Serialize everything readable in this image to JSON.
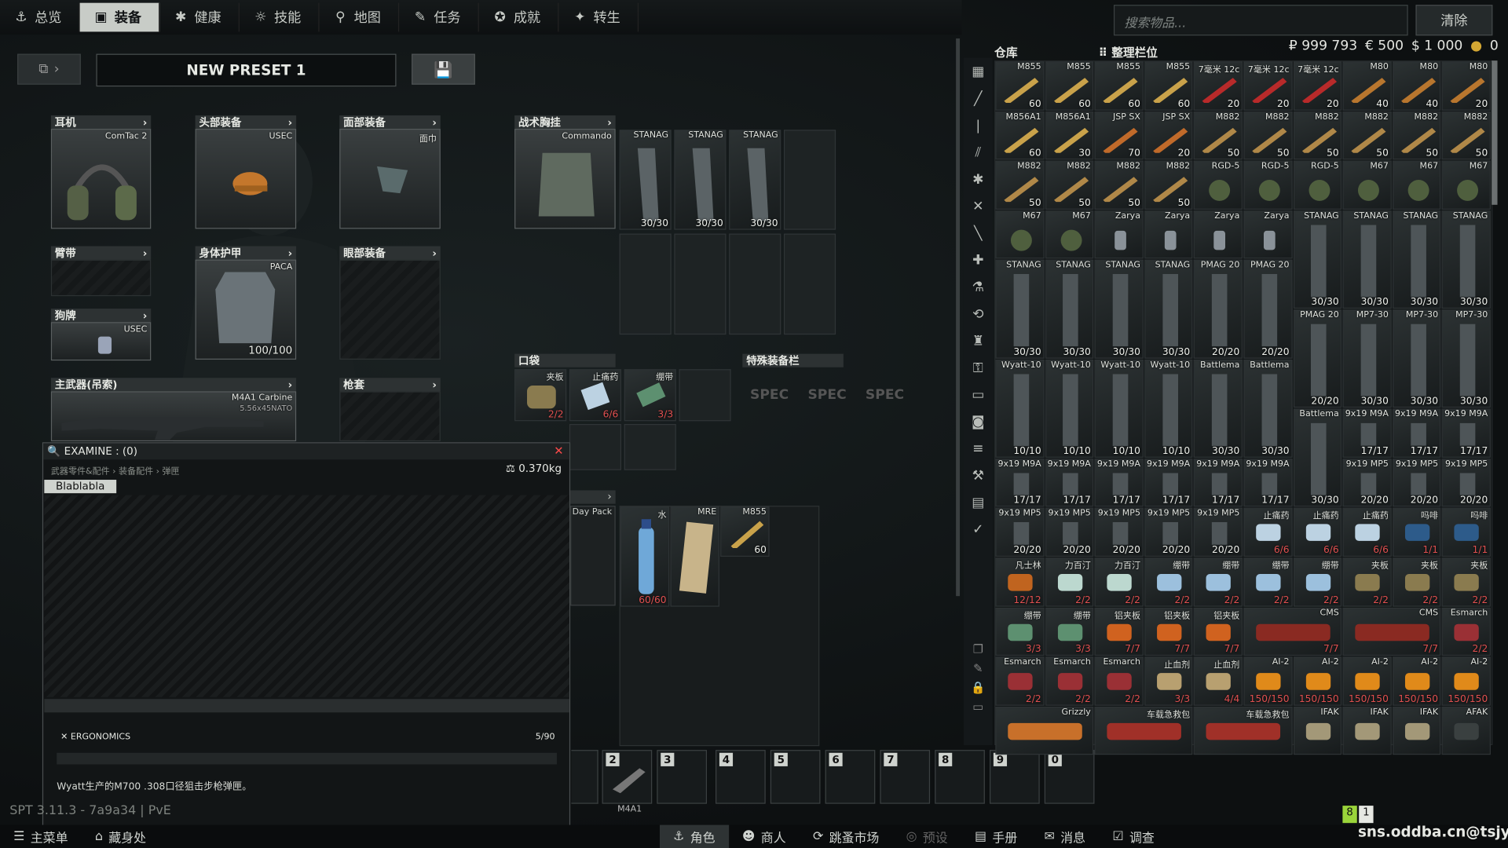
{
  "nav": {
    "tabs": [
      {
        "label": "总览",
        "icon": "person-icon"
      },
      {
        "label": "装备",
        "icon": "gear-icon",
        "active": true
      },
      {
        "label": "健康",
        "icon": "health-icon"
      },
      {
        "label": "技能",
        "icon": "skill-icon"
      },
      {
        "label": "地图",
        "icon": "map-pin-icon"
      },
      {
        "label": "任务",
        "icon": "task-icon"
      },
      {
        "label": "成就",
        "icon": "achievement-icon"
      },
      {
        "label": "转生",
        "icon": "prestige-icon"
      }
    ],
    "search_placeholder": "搜索物品...",
    "clear_label": "清除"
  },
  "preset": {
    "name": "NEW PRESET 1"
  },
  "slots": {
    "earpiece": {
      "header": "耳机",
      "item": "ComTac 2"
    },
    "headwear": {
      "header": "头部装备",
      "item": "USEC"
    },
    "facecover": {
      "header": "面部装备",
      "item": "面巾"
    },
    "armband": {
      "header": "臂带"
    },
    "armor": {
      "header": "身体护甲",
      "item": "PACA",
      "value": "100/100"
    },
    "eyewear": {
      "header": "眼部装备"
    },
    "dogtag": {
      "header": "狗牌",
      "item": "USEC"
    },
    "primary": {
      "header": "主武器(吊索)",
      "item": "M4A1 Carbine",
      "sub": "5.56x45NATO"
    },
    "holster": {
      "header": "枪套"
    },
    "rig": {
      "header": "战术胸挂",
      "item": "Commando",
      "mags": [
        {
          "name": "STANAG",
          "count": "30/30"
        },
        {
          "name": "STANAG",
          "count": "30/30"
        },
        {
          "name": "STANAG",
          "count": "30/30"
        }
      ]
    },
    "pockets": {
      "header": "口袋",
      "items": [
        {
          "name": "夹板",
          "count": "2/2"
        },
        {
          "name": "止痛药",
          "count": "6/6"
        },
        {
          "name": "绷带",
          "count": "3/3"
        }
      ]
    },
    "special": {
      "header": "特殊装备栏",
      "label": "SPEC"
    },
    "backpack": {
      "item": "Day Pack",
      "items": [
        {
          "name": "水",
          "count": "60/60"
        },
        {
          "name": "MRE",
          "count": ""
        },
        {
          "name": "M855",
          "count": "60"
        }
      ]
    }
  },
  "stash": {
    "title": "仓库",
    "sort_label": "整理栏位",
    "money": {
      "rub": "₽ 999 793",
      "eur": "€ 500",
      "usd": "$ 1 000",
      "gp": "0"
    },
    "items": [
      {
        "n": "M855",
        "q": "60",
        "c": "bullet"
      },
      {
        "n": "M855",
        "q": "60",
        "c": "bullet"
      },
      {
        "n": "M855",
        "q": "60",
        "c": "bullet"
      },
      {
        "n": "M855",
        "q": "60",
        "c": "bullet"
      },
      {
        "n": "7毫米 12c",
        "q": "20",
        "c": "shell"
      },
      {
        "n": "7毫米 12c",
        "q": "20",
        "c": "shell"
      },
      {
        "n": "7毫米 12c",
        "q": "20",
        "c": "shell"
      },
      {
        "n": "M80",
        "q": "40",
        "c": "bullet2"
      },
      {
        "n": "M80",
        "q": "40",
        "c": "bullet2"
      },
      {
        "n": "M80",
        "q": "20",
        "c": "bullet2"
      },
      {
        "n": "M856A1",
        "q": "60",
        "c": "bullet"
      },
      {
        "n": "M856A1",
        "q": "30",
        "c": "bullet"
      },
      {
        "n": "JSP SX",
        "q": "70",
        "c": "bullet3"
      },
      {
        "n": "JSP SX",
        "q": "20",
        "c": "bullet3"
      },
      {
        "n": "M882",
        "q": "50",
        "c": "bullet4"
      },
      {
        "n": "M882",
        "q": "50",
        "c": "bullet4"
      },
      {
        "n": "M882",
        "q": "50",
        "c": "bullet4"
      },
      {
        "n": "M882",
        "q": "50",
        "c": "bullet4"
      },
      {
        "n": "M882",
        "q": "50",
        "c": "bullet4"
      },
      {
        "n": "M882",
        "q": "50",
        "c": "bullet4"
      },
      {
        "n": "M882",
        "q": "50",
        "c": "bullet4"
      },
      {
        "n": "M882",
        "q": "50",
        "c": "bullet4"
      },
      {
        "n": "M882",
        "q": "50",
        "c": "bullet4"
      },
      {
        "n": "M882",
        "q": "50",
        "c": "bullet4"
      },
      {
        "n": "RGD-5",
        "q": "",
        "c": "grenade"
      },
      {
        "n": "RGD-5",
        "q": "",
        "c": "grenade"
      },
      {
        "n": "RGD-5",
        "q": "",
        "c": "grenade"
      },
      {
        "n": "M67",
        "q": "",
        "c": "grenade"
      },
      {
        "n": "M67",
        "q": "",
        "c": "grenade"
      },
      {
        "n": "M67",
        "q": "",
        "c": "grenade"
      },
      {
        "n": "M67",
        "q": "",
        "c": "grenade"
      },
      {
        "n": "M67",
        "q": "",
        "c": "grenade"
      },
      {
        "n": "Zarya",
        "q": "",
        "c": "flash"
      },
      {
        "n": "Zarya",
        "q": "",
        "c": "flash"
      },
      {
        "n": "Zarya",
        "q": "",
        "c": "flash"
      },
      {
        "n": "Zarya",
        "q": "",
        "c": "flash"
      }
    ],
    "mags_row1": [
      {
        "n": "STANAG",
        "q": "30/30"
      },
      {
        "n": "STANAG",
        "q": "30/30"
      },
      {
        "n": "STANAG",
        "q": "30/30"
      },
      {
        "n": "STANAG",
        "q": "30/30"
      }
    ],
    "mags_row2": [
      {
        "n": "STANAG",
        "q": "30/30"
      },
      {
        "n": "STANAG",
        "q": "30/30"
      },
      {
        "n": "STANAG",
        "q": "30/30"
      },
      {
        "n": "STANAG",
        "q": "30/30"
      },
      {
        "n": "PMAG 20",
        "q": "20/20"
      },
      {
        "n": "PMAG 20",
        "q": "20/20"
      }
    ],
    "mags_row3": [
      {
        "n": "PMAG 20",
        "q": "20/20"
      },
      {
        "n": "MP7-30",
        "q": "30/30"
      },
      {
        "n": "MP7-30",
        "q": "30/30"
      },
      {
        "n": "MP7-30",
        "q": "30/30"
      }
    ],
    "mags_row4": [
      {
        "n": "Wyatt-10",
        "q": "10/10"
      },
      {
        "n": "Wyatt-10",
        "q": "10/10"
      },
      {
        "n": "Wyatt-10",
        "q": "10/10"
      },
      {
        "n": "Wyatt-10",
        "q": "10/10"
      },
      {
        "n": "Battlema",
        "q": "30/30"
      },
      {
        "n": "Battlema",
        "q": "30/30"
      }
    ],
    "mags_row4b": [
      {
        "n": "Battlema",
        "q": "30/30"
      },
      {
        "n": "9x19 M9A",
        "q": "17/17"
      },
      {
        "n": "9x19 M9A",
        "q": "17/17"
      },
      {
        "n": "9x19 M9A",
        "q": "17/17"
      }
    ],
    "mags_row5": [
      {
        "n": "9x19 M9A",
        "q": "17/17"
      },
      {
        "n": "9x19 M9A",
        "q": "17/17"
      },
      {
        "n": "9x19 M9A",
        "q": "17/17"
      },
      {
        "n": "9x19 M9A",
        "q": "17/17"
      },
      {
        "n": "9x19 M9A",
        "q": "17/17"
      },
      {
        "n": "9x19 M9A",
        "q": "17/17"
      },
      {
        "n": "",
        "q": "17/17"
      }
    ],
    "mags_row5b": [
      {
        "n": "9x19 MP5",
        "q": "20/20"
      },
      {
        "n": "9x19 MP5",
        "q": "20/20"
      },
      {
        "n": "9x19 MP5",
        "q": "20/20"
      }
    ],
    "mags_row6": [
      {
        "n": "9x19 MP5",
        "q": "20/20"
      },
      {
        "n": "9x19 MP5",
        "q": "20/20"
      },
      {
        "n": "9x19 MP5",
        "q": "20/20"
      },
      {
        "n": "9x19 MP5",
        "q": "20/20"
      },
      {
        "n": "9x19 MP5",
        "q": "20/20"
      }
    ],
    "meds_row6": [
      {
        "n": "止痛药",
        "q": "6/6"
      },
      {
        "n": "止痛药",
        "q": "6/6"
      },
      {
        "n": "止痛药",
        "q": "6/6"
      },
      {
        "n": "吗啡",
        "q": "1/1"
      },
      {
        "n": "吗啡",
        "q": "1/1"
      }
    ],
    "meds_row7": [
      {
        "n": "凡士林",
        "q": "12/12"
      },
      {
        "n": "力百汀",
        "q": "2/2"
      },
      {
        "n": "力百汀",
        "q": "2/2"
      },
      {
        "n": "绷带",
        "q": "2/2"
      },
      {
        "n": "绷带",
        "q": "2/2"
      },
      {
        "n": "绷带",
        "q": "2/2"
      },
      {
        "n": "绷带",
        "q": "2/2"
      },
      {
        "n": "夹板",
        "q": "2/2"
      },
      {
        "n": "夹板",
        "q": "2/2"
      },
      {
        "n": "夹板",
        "q": "2/2"
      }
    ],
    "meds_row8": [
      {
        "n": "绷带",
        "q": "3/3"
      },
      {
        "n": "绷带",
        "q": "3/3"
      },
      {
        "n": "铝夹板",
        "q": "7/7"
      },
      {
        "n": "铝夹板",
        "q": "7/7"
      },
      {
        "n": "铝夹板",
        "q": "7/7"
      },
      {
        "n": "CMS",
        "q": "7/7"
      },
      {
        "n": "CMS",
        "q": "7/7"
      },
      {
        "n": "Esmarch",
        "q": "2/2"
      }
    ],
    "meds_row9": [
      {
        "n": "Esmarch",
        "q": "2/2"
      },
      {
        "n": "Esmarch",
        "q": "2/2"
      },
      {
        "n": "Esmarch",
        "q": "2/2"
      },
      {
        "n": "止血剂",
        "q": "3/3"
      },
      {
        "n": "止血剂",
        "q": "4/4"
      },
      {
        "n": "AI-2",
        "q": "150/150"
      },
      {
        "n": "AI-2",
        "q": "150/150"
      },
      {
        "n": "AI-2",
        "q": "150/150"
      },
      {
        "n": "AI-2",
        "q": "150/150"
      },
      {
        "n": "AI-2",
        "q": "150/150"
      }
    ],
    "meds_row10": [
      {
        "n": "Grizzly",
        "q": ""
      },
      {
        "n": "车载急救包",
        "q": ""
      },
      {
        "n": "车载急救包",
        "q": ""
      },
      {
        "n": "IFAK",
        "q": ""
      },
      {
        "n": "IFAK",
        "q": ""
      },
      {
        "n": "IFAK",
        "q": ""
      },
      {
        "n": "AFAK",
        "q": ""
      }
    ]
  },
  "examine": {
    "title": "EXAMINE : (0)",
    "breadcrumb": "武器零件&配件 › 装备配件 › 弹匣",
    "weight": "0.370kg",
    "selected": "Blablabla",
    "ergonomics_label": "ERGONOMICS",
    "ergonomics_value": "5/90",
    "description": "Wyatt生产的M700 .308口径狙击步枪弹匣。"
  },
  "hotbar": {
    "slots": [
      "2",
      "3",
      "4",
      "5",
      "6",
      "7",
      "8",
      "9",
      "0"
    ],
    "weapon_label": "M4A1"
  },
  "bottom": {
    "main_menu": "主菜单",
    "hideout": "藏身处",
    "buttons": [
      {
        "label": "角色",
        "active": true
      },
      {
        "label": "商人"
      },
      {
        "label": "跳蚤市场"
      },
      {
        "label": "预设"
      },
      {
        "label": "手册"
      },
      {
        "label": "消息"
      },
      {
        "label": "调查"
      }
    ]
  },
  "version": "SPT 3.11.3 - 7a9a34 | PvE",
  "watermark": "sns.oddba.cn@tsjy",
  "status": {
    "badge1": "8",
    "badge2": "1"
  }
}
